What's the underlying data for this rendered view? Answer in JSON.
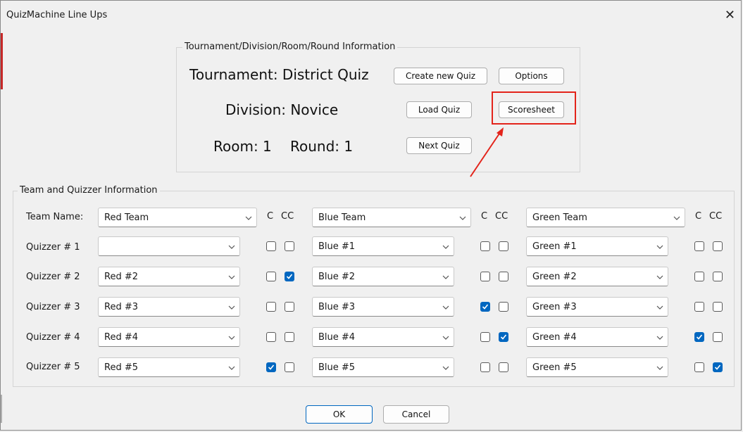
{
  "window": {
    "title": "QuizMachine Line Ups",
    "close_glyph": "✕"
  },
  "tournament_group": {
    "legend": "Tournament/Division/Room/Round Information",
    "tournament": "Tournament: District Quiz",
    "division": "Division: Novice",
    "room": "Room: 1",
    "round": "Round: 1",
    "buttons": {
      "create_new_quiz": "Create new Quiz",
      "options": "Options",
      "load_quiz": "Load Quiz",
      "scoresheet": "Scoresheet",
      "next_quiz": "Next Quiz"
    }
  },
  "team_group": {
    "legend": "Team and Quizzer Information",
    "team_name_label": "Team Name:",
    "c_header": "C",
    "cc_header": "CC",
    "row_labels": [
      "Quizzer # 1",
      "Quizzer # 2",
      "Quizzer # 3",
      "Quizzer # 4",
      "Quizzer # 5"
    ],
    "teams": [
      {
        "name": "Red Team",
        "quizzers": [
          "",
          "Red #2",
          "Red #3",
          "Red #4",
          "Red #5"
        ],
        "c": [
          false,
          false,
          false,
          false,
          true
        ],
        "cc": [
          false,
          true,
          false,
          false,
          false
        ]
      },
      {
        "name": "Blue Team",
        "quizzers": [
          "Blue #1",
          "Blue #2",
          "Blue #3",
          "Blue #4",
          "Blue #5"
        ],
        "c": [
          false,
          false,
          true,
          false,
          false
        ],
        "cc": [
          false,
          false,
          false,
          true,
          false
        ]
      },
      {
        "name": "Green Team",
        "quizzers": [
          "Green #1",
          "Green #2",
          "Green #3",
          "Green #4",
          "Green #5"
        ],
        "c": [
          false,
          false,
          false,
          true,
          false
        ],
        "cc": [
          false,
          false,
          false,
          false,
          true
        ]
      }
    ]
  },
  "footer": {
    "ok": "OK",
    "cancel": "Cancel"
  },
  "colors": {
    "accent": "#0067c0",
    "annotation": "#e3241b"
  },
  "icons": {
    "dropdown": "chevron-down-icon",
    "check": "checkmark-icon"
  }
}
